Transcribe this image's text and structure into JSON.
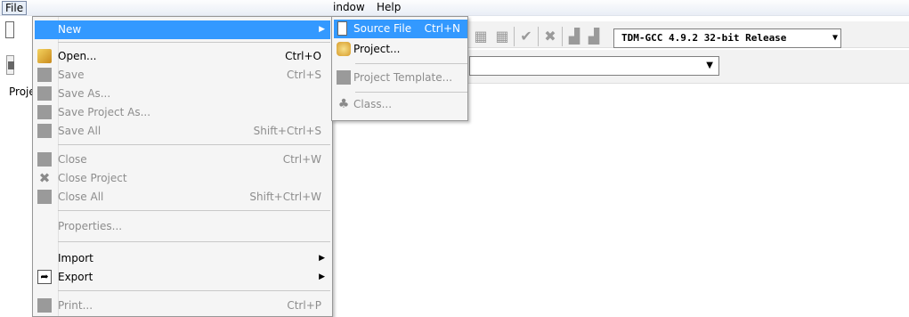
{
  "menubar": {
    "file": "File",
    "window": "indow",
    "help": "Help"
  },
  "left_strip": {
    "tab": "Proje"
  },
  "toolbar": {
    "compiler": "TDM-GCC 4.9.2 32-bit Release"
  },
  "file_menu": {
    "items": [
      {
        "label": "New",
        "shortcut": "",
        "state": "highlighted"
      },
      {
        "label": "Open...",
        "shortcut": "Ctrl+O",
        "state": "enabled"
      },
      {
        "label": "Save",
        "shortcut": "Ctrl+S",
        "state": "disabled"
      },
      {
        "label": "Save As...",
        "shortcut": "",
        "state": "disabled"
      },
      {
        "label": "Save Project As...",
        "shortcut": "",
        "state": "disabled"
      },
      {
        "label": "Save All",
        "shortcut": "Shift+Ctrl+S",
        "state": "disabled"
      },
      {
        "label": "Close",
        "shortcut": "Ctrl+W",
        "state": "disabled"
      },
      {
        "label": "Close Project",
        "shortcut": "",
        "state": "disabled"
      },
      {
        "label": "Close All",
        "shortcut": "Shift+Ctrl+W",
        "state": "disabled"
      },
      {
        "label": "Properties...",
        "shortcut": "",
        "state": "disabled"
      },
      {
        "label": "Import",
        "shortcut": "",
        "state": "enabled"
      },
      {
        "label": "Export",
        "shortcut": "",
        "state": "enabled"
      },
      {
        "label": "Print...",
        "shortcut": "Ctrl+P",
        "state": "disabled"
      }
    ]
  },
  "new_submenu": {
    "items": [
      {
        "label": "Source File",
        "shortcut": "Ctrl+N",
        "state": "highlighted"
      },
      {
        "label": "Project...",
        "shortcut": "",
        "state": "enabled"
      },
      {
        "label": "Project Template...",
        "shortcut": "",
        "state": "disabled"
      },
      {
        "label": "Class...",
        "shortcut": "",
        "state": "disabled"
      }
    ]
  },
  "icons": {
    "new": "new-file-icon",
    "open": "open-folder-icon",
    "save": "save-icon",
    "close": "close-file-icon",
    "close_project": "close-project-icon",
    "export": "export-icon",
    "print": "print-icon",
    "source_file": "source-file-icon",
    "project": "project-icon",
    "class": "class-icon"
  },
  "colors": {
    "highlight": "#3399ff",
    "disabled_text": "#8d8d8d",
    "menu_bg": "#f5f5f5"
  }
}
